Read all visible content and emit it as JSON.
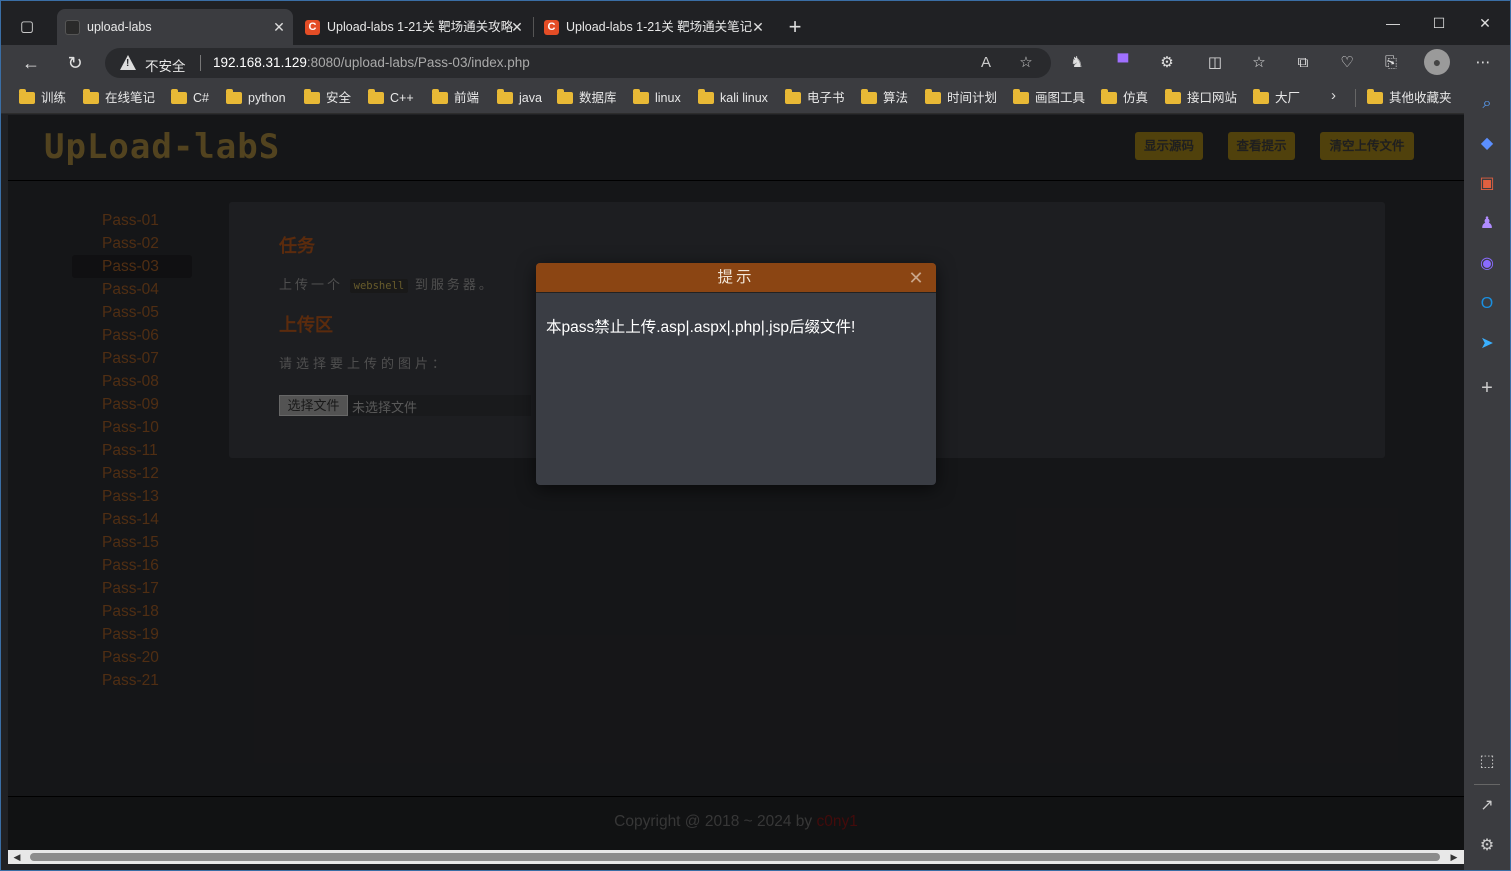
{
  "tabs": [
    {
      "title": "upload-labs",
      "active": true
    },
    {
      "title": "Upload-labs 1-21关 靶场通关攻略",
      "active": false
    },
    {
      "title": "Upload-labs 1-21关 靶场通关笔记",
      "active": false
    }
  ],
  "address": {
    "security_label": "不安全",
    "host": "192.168.31.129",
    "path": ":8080/upload-labs/Pass-03/index.php"
  },
  "bookmarks": [
    "训练",
    "在线笔记",
    "C#",
    "python",
    "安全",
    "C++",
    "前端",
    "java",
    "数据库",
    "linux",
    "kali linux",
    "电子书",
    "算法",
    "时间计划",
    "画图工具",
    "仿真",
    "接口网站",
    "大厂"
  ],
  "other_bookmarks": "其他收藏夹",
  "site": {
    "logo": "UpLoad-labS",
    "buttons": [
      "显示源码",
      "查看提示",
      "清空上传文件"
    ],
    "passes": [
      "Pass-01",
      "Pass-02",
      "Pass-03",
      "Pass-04",
      "Pass-05",
      "Pass-06",
      "Pass-07",
      "Pass-08",
      "Pass-09",
      "Pass-10",
      "Pass-11",
      "Pass-12",
      "Pass-13",
      "Pass-14",
      "Pass-15",
      "Pass-16",
      "Pass-17",
      "Pass-18",
      "Pass-19",
      "Pass-20",
      "Pass-21"
    ],
    "current_pass": "Pass-03",
    "task_title": "任务",
    "task_before": "上传一个",
    "task_code": "webshell",
    "task_after": "到服务器。",
    "upload_title": "上传区",
    "select_label": "请选择要上传的图片：",
    "file_button": "选择文件",
    "file_status": "未选择文件",
    "footer_prefix": "Copyright @ 2018 ~ 2024 by ",
    "footer_author": "c0ny1"
  },
  "modal": {
    "title": "提示",
    "message": "本pass禁止上传.asp|.aspx|.php|.jsp后缀文件!"
  },
  "colors": {
    "accent": "#8b4513",
    "header_button": "#6b5711",
    "pass_link": "#6b3e1a"
  }
}
